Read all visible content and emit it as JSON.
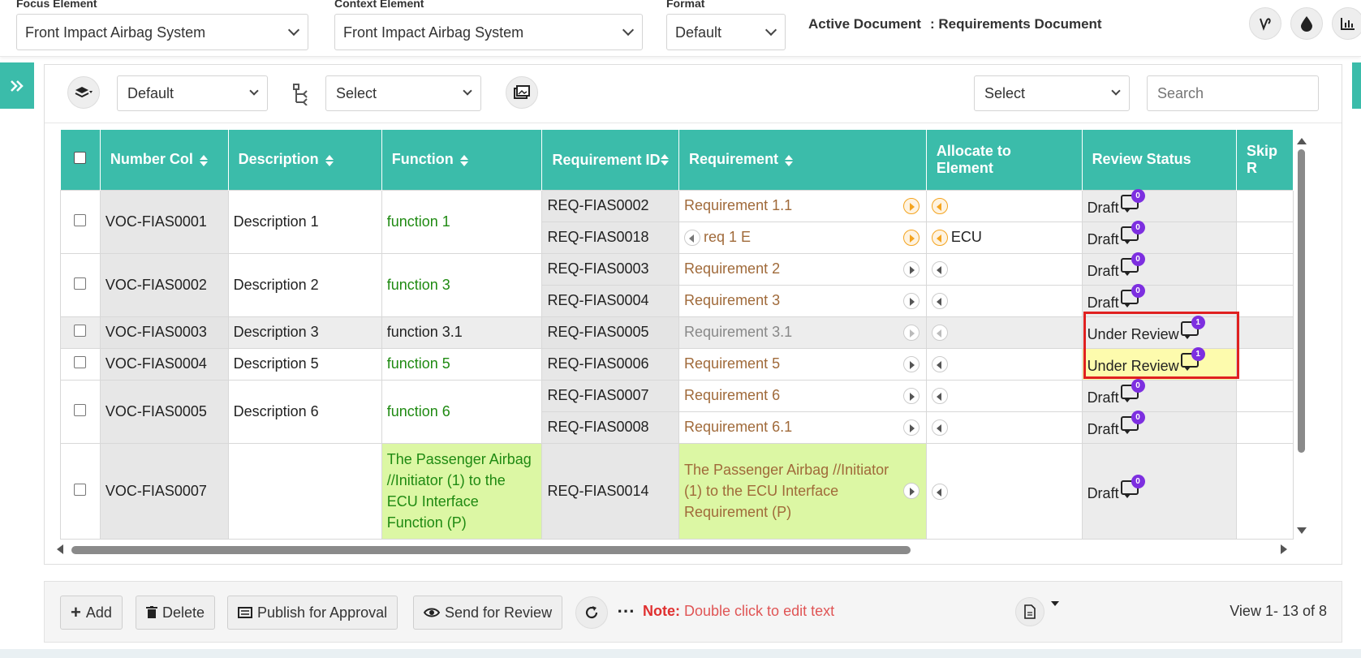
{
  "header": {
    "focus_label": "Focus Element",
    "focus_value": "Front Impact Airbag System",
    "context_label": "Context Element",
    "context_value": "Front Impact Airbag System",
    "format_label": "Format",
    "format_value": "Default",
    "active_doc_label": "Active Document",
    "active_doc_value": ": Requirements Document"
  },
  "toolbar": {
    "layer_select": "Default",
    "hierarchy_select": "Select",
    "filter_select": "Select",
    "search_placeholder": "Search"
  },
  "table": {
    "columns": [
      "Number Col",
      "Description",
      "Function",
      "Requirement ID",
      "Requirement",
      "Allocate to Element",
      "Review Status",
      "Skip R"
    ],
    "groups": [
      {
        "number": "VOC-FIAS0001",
        "description": "Description 1",
        "function": "function 1",
        "rows": [
          {
            "req_id": "REQ-FIAS0002",
            "requirement": "Requirement 1.1",
            "allocate": "",
            "status": "Draft",
            "comments": "0"
          },
          {
            "req_id": "REQ-FIAS0018",
            "requirement": "req 1 E",
            "allocate": "ECU",
            "status": "Draft",
            "comments": "0"
          }
        ]
      },
      {
        "number": "VOC-FIAS0002",
        "description": "Description 2",
        "function": "function 3",
        "rows": [
          {
            "req_id": "REQ-FIAS0003",
            "requirement": "Requirement 2",
            "allocate": "",
            "status": "Draft",
            "comments": "0"
          },
          {
            "req_id": "REQ-FIAS0004",
            "requirement": "Requirement 3",
            "allocate": "",
            "status": "Draft",
            "comments": "0"
          }
        ]
      },
      {
        "number": "VOC-FIAS0003",
        "description": "Description 3",
        "function": "function 3.1",
        "rows": [
          {
            "req_id": "REQ-FIAS0005",
            "requirement": "Requirement 3.1",
            "allocate": "",
            "status": "Under Review",
            "comments": "1"
          }
        ]
      },
      {
        "number": "VOC-FIAS0004",
        "description": "Description 5",
        "function": "function 5",
        "rows": [
          {
            "req_id": "REQ-FIAS0006",
            "requirement": "Requirement 5",
            "allocate": "",
            "status": "Under Review",
            "comments": "1"
          }
        ]
      },
      {
        "number": "VOC-FIAS0005",
        "description": "Description 6",
        "function": "function 6",
        "rows": [
          {
            "req_id": "REQ-FIAS0007",
            "requirement": "Requirement 6",
            "allocate": "",
            "status": "Draft",
            "comments": "0"
          },
          {
            "req_id": "REQ-FIAS0008",
            "requirement": "Requirement 6.1",
            "allocate": "",
            "status": "Draft",
            "comments": "0"
          }
        ]
      },
      {
        "number": "VOC-FIAS0007",
        "description": "",
        "function": "The Passenger Airbag //Initiator (1) to the ECU Interface Function (P)",
        "rows": [
          {
            "req_id": "REQ-FIAS0014",
            "requirement": "The Passenger Airbag //Initiator (1) to the ECU Interface Requirement (P)",
            "allocate": "",
            "status": "Draft",
            "comments": "0"
          }
        ]
      }
    ]
  },
  "footer": {
    "add": "Add",
    "delete": "Delete",
    "publish": "Publish for Approval",
    "send_review": "Send for Review",
    "note_label": "Note:",
    "note_text": "Double click to edit text",
    "view_count": "View 1- 13 of 8"
  },
  "colors": {
    "accent": "#3bbcaa",
    "function_text": "#1f8a12",
    "requirement_text": "#a06a3a",
    "badge": "#7d2fe0",
    "highlight_box": "#e02020"
  }
}
